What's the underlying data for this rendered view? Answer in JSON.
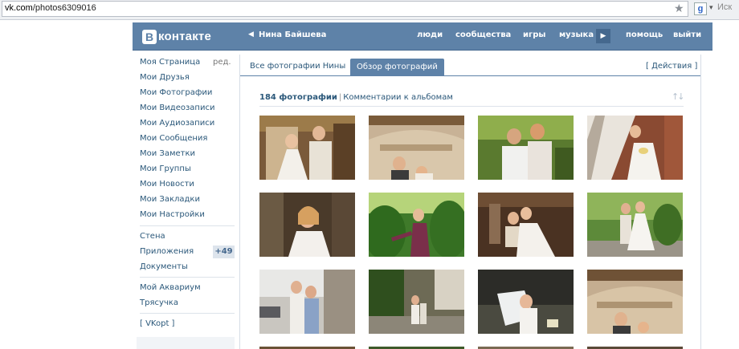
{
  "browser": {
    "url_host": "vk.com",
    "url_path": "/photos6309016",
    "search_text": "Иск"
  },
  "header": {
    "logo_letter": "B",
    "logo_text": "контакте",
    "user_name": "Нина Байшева",
    "nav": [
      {
        "label": "люди"
      },
      {
        "label": "сообщества"
      },
      {
        "label": "игры"
      },
      {
        "label": "музыка"
      },
      {
        "label": "помощь"
      },
      {
        "label": "выйти"
      }
    ]
  },
  "sidebar": {
    "edit_label": "ред.",
    "main_items": [
      {
        "label": "Моя Страница"
      },
      {
        "label": "Мои Друзья"
      },
      {
        "label": "Мои Фотографии"
      },
      {
        "label": "Мои Видеозаписи"
      },
      {
        "label": "Мои Аудиозаписи"
      },
      {
        "label": "Мои Сообщения"
      },
      {
        "label": "Мои Заметки"
      },
      {
        "label": "Мои Группы"
      },
      {
        "label": "Мои Новости"
      },
      {
        "label": "Мои Закладки"
      },
      {
        "label": "Мои Настройки"
      }
    ],
    "app_items": [
      {
        "label": "Стена"
      },
      {
        "label": "Приложения"
      },
      {
        "label": "Документы"
      }
    ],
    "apps_badge": "+49",
    "extra_items": [
      {
        "label": "Мой Аквариум"
      },
      {
        "label": "Трясучка"
      }
    ],
    "vkopt_label": "[ VKopt ]"
  },
  "content": {
    "tabs": [
      {
        "label": "Все фотографии Нины"
      },
      {
        "label": "Обзор фотографий"
      }
    ],
    "actions_label": "[ Действия ]",
    "photos_count": "184 фотографии",
    "separator": "|",
    "album_comments": "Комментарии к альбомам"
  },
  "colors": {
    "header_bg": "#5e82a8",
    "link": "#2b587a",
    "active_tab": "#5e82a8"
  },
  "icons": [
    "star-icon",
    "google-icon",
    "back-arrow-icon",
    "play-icon",
    "sort-icon"
  ]
}
